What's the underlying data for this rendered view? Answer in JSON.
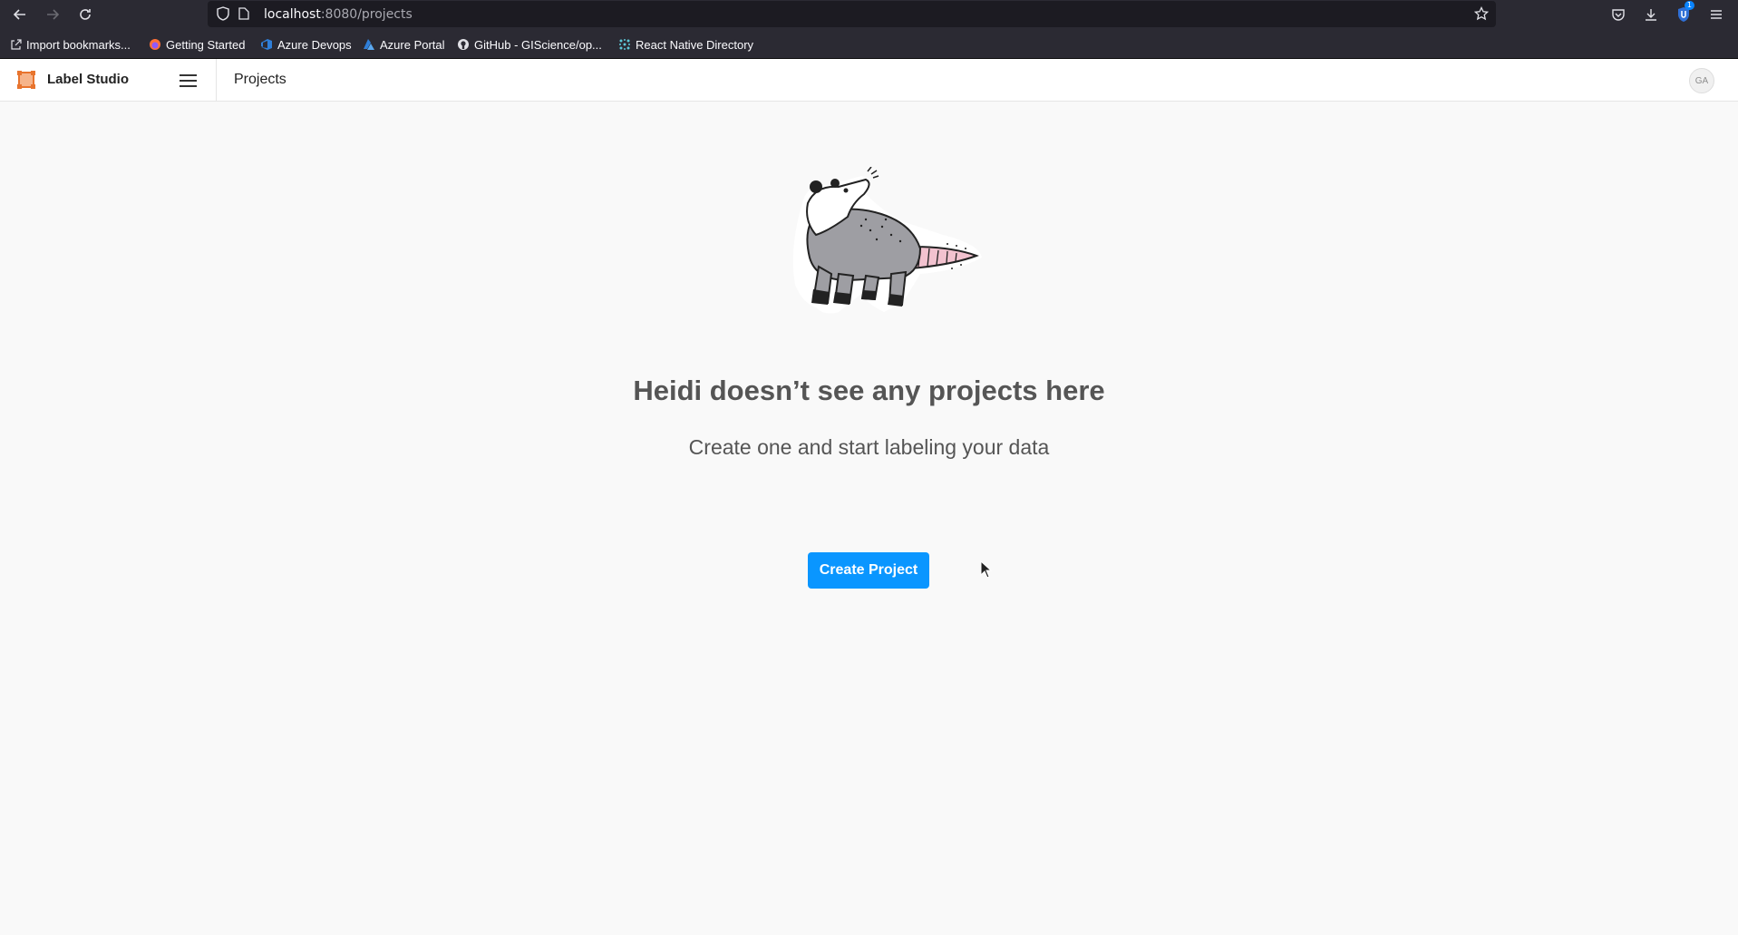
{
  "browser": {
    "url_host": "localhost",
    "url_rest": ":8080/projects",
    "bookmarks": [
      {
        "label": "Import bookmarks...",
        "icon": "import-icon"
      },
      {
        "label": "Getting Started",
        "icon": "firefox-icon"
      },
      {
        "label": "Azure Devops",
        "icon": "azure-devops-icon"
      },
      {
        "label": "Azure Portal",
        "icon": "azure-icon"
      },
      {
        "label": "GitHub - GIScience/op...",
        "icon": "github-icon"
      },
      {
        "label": "React Native Directory",
        "icon": "react-icon"
      }
    ],
    "extension_badge": "1"
  },
  "app": {
    "name": "Label Studio",
    "page_title": "Projects",
    "avatar_initials": "GA",
    "brand_color": "#e8742e"
  },
  "empty_state": {
    "headline": "Heidi doesn’t see any projects here",
    "subline": "Create one and start labeling your data",
    "button_label": "Create Project",
    "button_color": "#0a96ff"
  }
}
